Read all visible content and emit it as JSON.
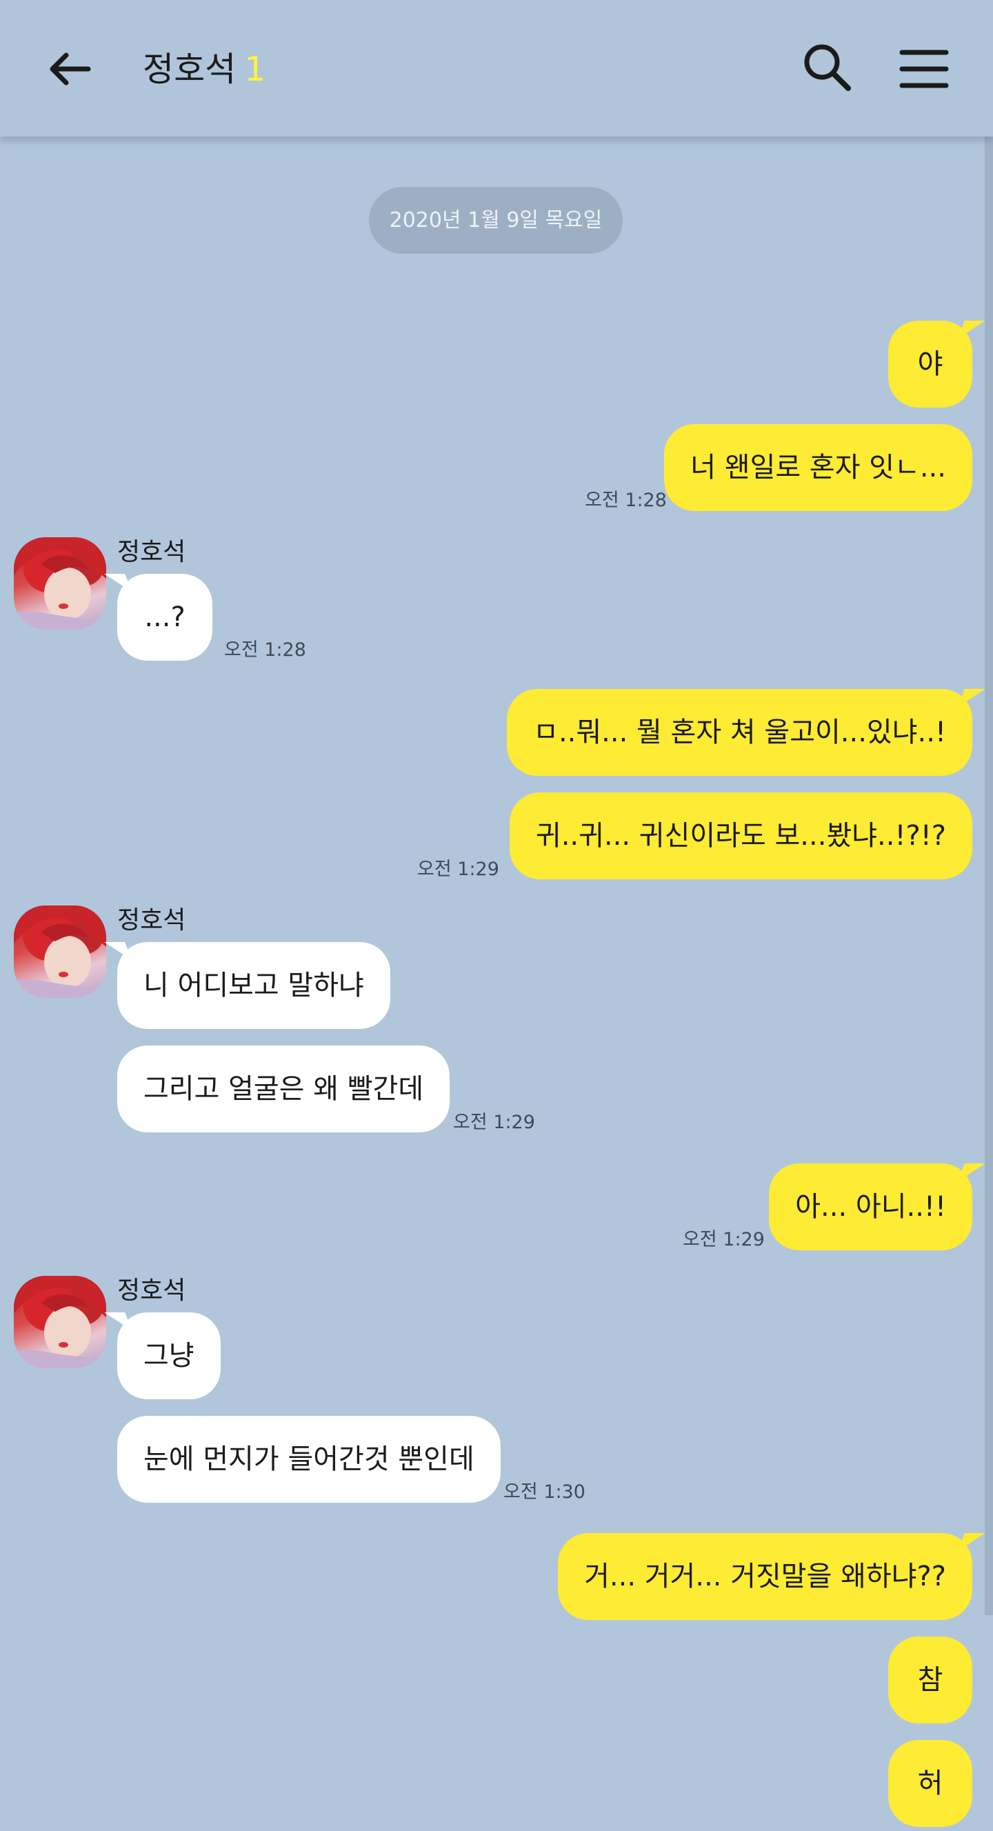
{
  "header": {
    "title": "정호석",
    "unread_count": "1"
  },
  "date_divider": "2020년 1월 9일 목요일",
  "messages": [
    {
      "from": "me",
      "text": "야"
    },
    {
      "from": "me",
      "text": "너 왠일로 혼자 잇ㄴ...",
      "time": "오전 1:28"
    },
    {
      "from": "other",
      "sender": "정호석",
      "text": "...?",
      "time": "오전 1:28"
    },
    {
      "from": "me",
      "text": "ㅁ..뭐... 뭘 혼자 쳐 울고이...있냐..!"
    },
    {
      "from": "me",
      "text": "귀..귀... 귀신이라도 보...봤냐..!?!?",
      "time": "오전 1:29"
    },
    {
      "from": "other",
      "sender": "정호석",
      "text": "니 어디보고 말하냐"
    },
    {
      "from": "other",
      "text": "그리고 얼굴은 왜 빨간데",
      "time": "오전 1:29"
    },
    {
      "from": "me",
      "text": "아... 아니..!!",
      "time": "오전 1:29"
    },
    {
      "from": "other",
      "sender": "정호석",
      "text": "그냥"
    },
    {
      "from": "other",
      "text": "눈에 먼지가 들어간것 뿐인데",
      "time": "오전 1:30"
    },
    {
      "from": "me",
      "text": "거... 거거... 거짓말을 왜하냐??"
    },
    {
      "from": "me",
      "text": "참"
    },
    {
      "from": "me",
      "text": "허"
    }
  ],
  "colors": {
    "background": "#b1c6db",
    "my_bubble": "#feeb34",
    "other_bubble": "#ffffff",
    "unread": "#fff23a"
  },
  "icons": {
    "back": "arrow-left-icon",
    "search": "search-icon",
    "menu": "hamburger-menu-icon"
  }
}
